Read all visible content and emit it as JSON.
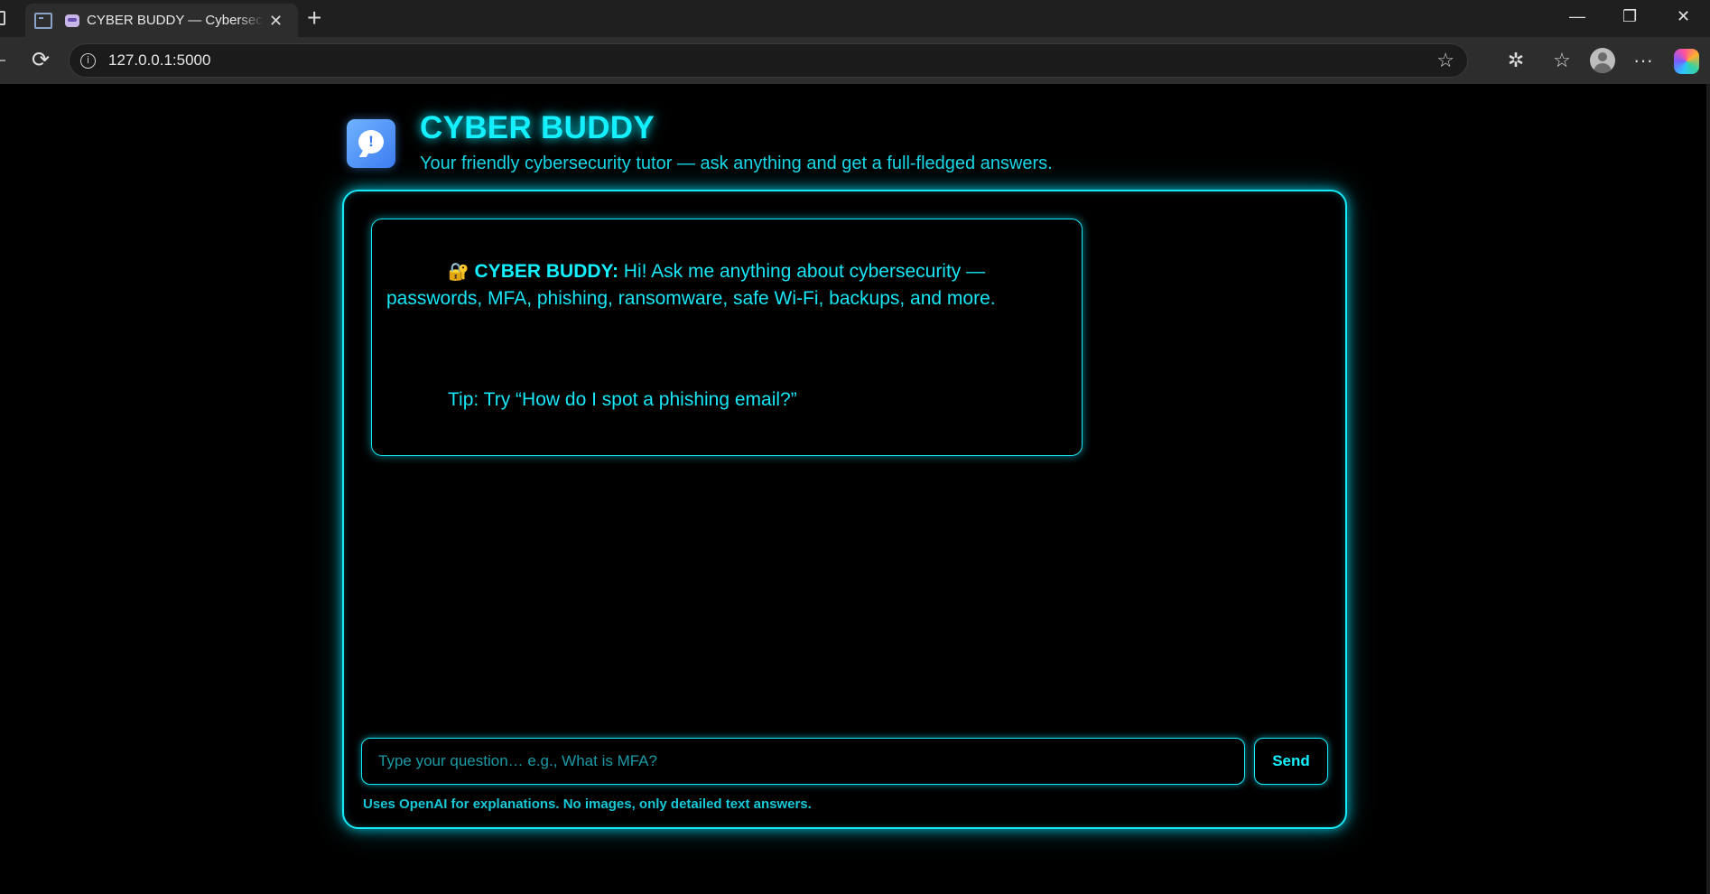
{
  "browser": {
    "tab_title": "CYBER BUDDY — Cybersecurity Tutor",
    "tab_close": "✕",
    "new_tab": "+",
    "url": "127.0.0.1:5000",
    "window_controls": {
      "minimize": "—",
      "restore": "❐",
      "close": "✕"
    },
    "toolbar_icons": [
      "extensions-icon",
      "favorites-icon",
      "profile-icon",
      "more-icon",
      "copilot-icon"
    ],
    "more_label": "···"
  },
  "app": {
    "title": "CYBER BUDDY",
    "subtitle": "Your friendly cybersecurity tutor — ask anything and get a full-fledged answers."
  },
  "chat": {
    "messages": [
      {
        "sender": "CYBER BUDDY:",
        "icon": "lock-icon",
        "icon_glyph": "🔐",
        "text": " Hi! Ask me anything about cybersecurity — passwords, MFA, phishing, ransomware, safe Wi-Fi, backups, and more.",
        "tip": "Tip: Try “How do I spot a phishing email?”"
      }
    ]
  },
  "composer": {
    "placeholder": "Type your question… e.g., What is MFA?",
    "value": "",
    "send_label": "Send",
    "footnote": "Uses OpenAI for explanations. No images, only detailed text answers."
  },
  "colors": {
    "accent": "#17e8f5",
    "background": "#000000",
    "logo_blue": "#3d7cf0"
  }
}
